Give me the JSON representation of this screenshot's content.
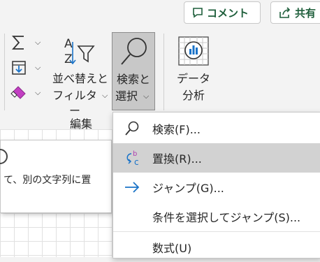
{
  "topbar": {
    "comment_label": "コメント",
    "share_label": "共有"
  },
  "ribbon": {
    "sort_filter_line1": "並べ替えと",
    "sort_filter_line2": "フィルター",
    "find_select_line1": "検索と",
    "find_select_line2": "選択",
    "data_analysis_line1": "データ",
    "data_analysis_line2": "分析",
    "group_label": "編集"
  },
  "tooltip": {
    "text": "て、別の文字列に置"
  },
  "menu": {
    "items": [
      {
        "label": "検索(F)...",
        "icon": "search-icon"
      },
      {
        "label": "置換(R)...",
        "icon": "replace-icon"
      },
      {
        "label": "ジャンプ(G)...",
        "icon": "arrow-right-icon"
      },
      {
        "label": "条件を選択してジャンプ(S)...",
        "icon": ""
      },
      {
        "label": "数式(U)",
        "icon": ""
      }
    ],
    "hovered_index": 1
  },
  "colors": {
    "accent_green": "#1e5e3b",
    "hover_gray": "#d2d2d2",
    "find_button_active": "#c8c8c8"
  }
}
